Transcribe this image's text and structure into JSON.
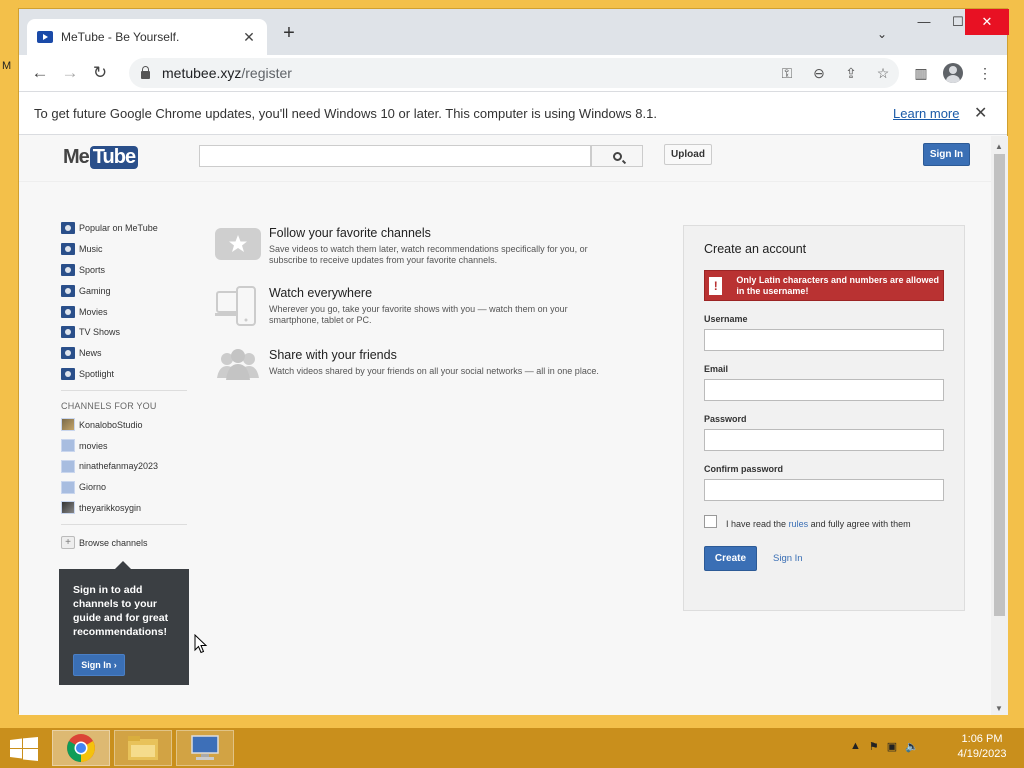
{
  "browser": {
    "tab_title": "MeTube - Be Yourself.",
    "url_host": "metubee.xyz",
    "url_path": "/register"
  },
  "infobar": {
    "message": "To get future Google Chrome updates, you'll need Windows 10 or later. This computer is using Windows 8.1.",
    "link": "Learn more"
  },
  "site": {
    "logo_left": "Me",
    "logo_right": "Tube",
    "upload": "Upload",
    "signin": "Sign In"
  },
  "guide": {
    "items": [
      {
        "label": "Popular on MeTube",
        "icon": "popular-icon"
      },
      {
        "label": "Music",
        "icon": "music-icon"
      },
      {
        "label": "Sports",
        "icon": "sports-icon"
      },
      {
        "label": "Gaming",
        "icon": "gaming-icon"
      },
      {
        "label": "Movies",
        "icon": "movies-icon"
      },
      {
        "label": "TV Shows",
        "icon": "tv-shows-icon"
      },
      {
        "label": "News",
        "icon": "news-icon"
      },
      {
        "label": "Spotlight",
        "icon": "spotlight-icon"
      }
    ],
    "channels_heading": "CHANNELS FOR YOU",
    "channels": [
      "KonaloboStudio",
      "movies",
      "ninathefanmay2023",
      "Giorno",
      "theyarikkosygin"
    ],
    "browse": "Browse channels"
  },
  "promo": {
    "text": "Sign in to add channels to your guide and for great recommendations!",
    "button": "Sign In ›"
  },
  "features": [
    {
      "title": "Follow your favorite channels",
      "desc": "Save videos to watch them later, watch recommendations specifically for you, or subscribe to receive updates from your favorite channels."
    },
    {
      "title": "Watch everywhere",
      "desc": "Wherever you go, take your favorite shows with you — watch them on your smartphone, tablet or PC."
    },
    {
      "title": "Share with your friends",
      "desc": "Watch videos shared by your friends on all your social networks — all in one place."
    }
  ],
  "signup": {
    "title": "Create an account",
    "error": "Only Latin characters and numbers are allowed in the username!",
    "username_label": "Username",
    "username_value": "",
    "email_label": "Email",
    "email_value": "",
    "password_label": "Password",
    "password_value": "",
    "confirm_label": "Confirm password",
    "confirm_value": "",
    "agree_pre": "I have read the",
    "agree_link": "rules",
    "agree_post": "and fully agree with them",
    "create": "Create",
    "signin": "Sign In"
  },
  "taskbar": {
    "time": "1:06 PM",
    "date": "4/19/2023"
  },
  "desktop": {
    "stray_label": "M"
  }
}
